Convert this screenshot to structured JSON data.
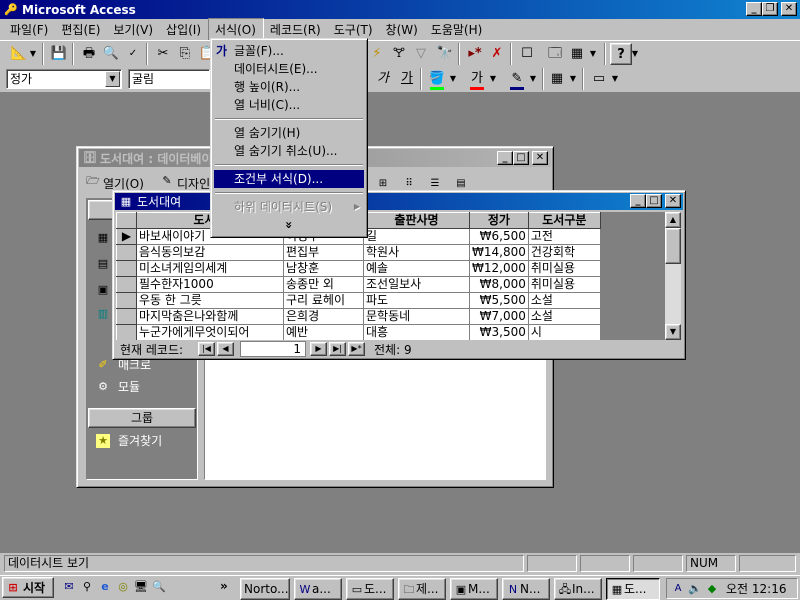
{
  "app": {
    "title": "Microsoft Access",
    "caption_buttons": [
      "_",
      "▣",
      "✕"
    ]
  },
  "menubar": [
    "파일(F)",
    "편집(E)",
    "보기(V)",
    "삽입(I)",
    "서식(O)",
    "레코드(R)",
    "도구(T)",
    "창(W)",
    "도움말(H)"
  ],
  "toolbar2": {
    "object_combo": "정가",
    "font_combo": "굴림",
    "italic": "가",
    "underline": "가",
    "fontcolor": "가"
  },
  "format_menu": {
    "items": [
      "글꼴(F)...",
      "데이터시트(E)...",
      "행 높이(R)...",
      "열 너비(C)...",
      "열 숨기기(H)",
      "열 숨기기 취소(U)...",
      "조건부 서식(D)...",
      "하위 데이터시트(S)"
    ],
    "expand": "»",
    "highlighted": "조건부 서식(D)...",
    "glyph": "가"
  },
  "db_window": {
    "title": "도서대여 : 데이터베이스",
    "open_label": "열기(O)",
    "design_label": "디자인",
    "objects": [
      "매크로",
      "모듈"
    ],
    "group_header": "그룹",
    "favorites": "즐겨찾기"
  },
  "datasheet": {
    "title": "도서대여",
    "columns": [
      "도서명",
      "저자",
      "출판사명",
      "정가",
      "도서구분"
    ],
    "rows": [
      [
        "바보새이야기",
        "이성부",
        "길",
        "₩6,500",
        "고전"
      ],
      [
        "음식동의보감",
        "편집부",
        "학원사",
        "₩14,800",
        "건강회학"
      ],
      [
        "미소녀게임의세계",
        "남창훈",
        "예솔",
        "₩12,000",
        "취미실용"
      ],
      [
        "필수한자1000",
        "송종만 외",
        "조선일보사",
        "₩8,000",
        "취미실용"
      ],
      [
        "우동 한 그릇",
        "구리 료헤이",
        "파도",
        "₩5,500",
        "소설"
      ],
      [
        "마지막춤은나와함께",
        "은희경",
        "문학동네",
        "₩7,000",
        "소설"
      ],
      [
        "누군가에게무엇이되어",
        "예반",
        "대흥",
        "₩3,500",
        "시"
      ]
    ],
    "nav": {
      "label": "현재 레코드:",
      "current": "1",
      "total": "전체: 9"
    }
  },
  "status": {
    "text": "데이터시트 보기",
    "num": "NUM"
  },
  "taskbar": {
    "start": "시작",
    "overflow": "»",
    "buttons": [
      "Norto...",
      "a...",
      "도...",
      "제...",
      "M...",
      "N...",
      "In...",
      "도..."
    ],
    "clock": "오전 12:16"
  }
}
